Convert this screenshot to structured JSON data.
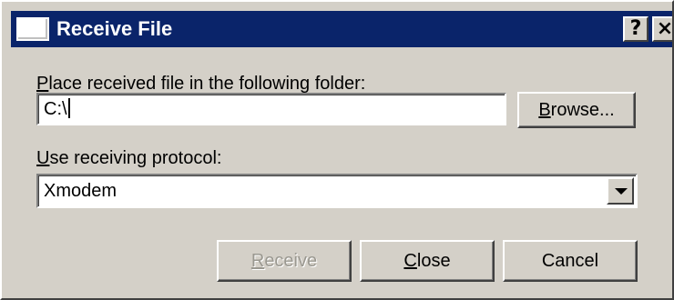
{
  "window": {
    "title": "Receive File",
    "help_glyph": "?",
    "close_glyph": "×"
  },
  "folder": {
    "label_accel": "P",
    "label_rest": "lace received file in the following folder:",
    "value": "C:\\"
  },
  "browse_button": {
    "accel": "B",
    "rest": "rowse..."
  },
  "protocol": {
    "label_accel": "U",
    "label_rest": "se receiving protocol:",
    "selected": "Xmodem"
  },
  "buttons": {
    "receive": {
      "accel": "R",
      "rest": "eceive",
      "enabled": false
    },
    "close": {
      "accel": "C",
      "rest": "lose"
    },
    "cancel": {
      "label": "Cancel"
    }
  },
  "icons": {
    "title": "window-icon",
    "help": "help-icon",
    "close": "close-icon",
    "dropdown": "chevron-down-icon"
  }
}
